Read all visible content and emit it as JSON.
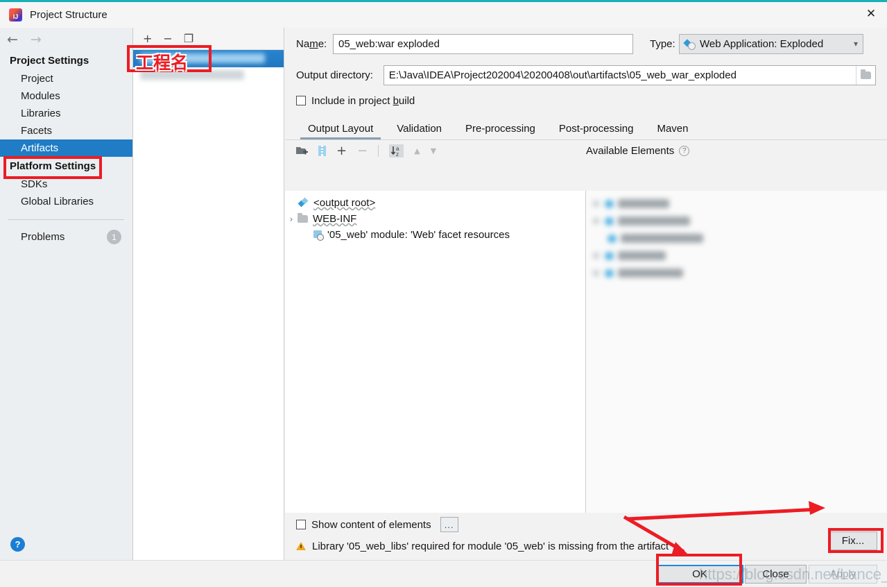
{
  "window": {
    "title": "Project Structure",
    "logo_icon": "intellij-idea-logo",
    "close_icon": "close-icon",
    "accent_color": "#18b0b8"
  },
  "nav": {
    "back_icon": "arrow-left-icon",
    "forward_icon": "arrow-right-icon"
  },
  "sidebar": {
    "project_settings_header": "Project Settings",
    "project_items": [
      {
        "label": "Project"
      },
      {
        "label": "Modules"
      },
      {
        "label": "Libraries"
      },
      {
        "label": "Facets"
      },
      {
        "label": "Artifacts"
      }
    ],
    "selected_item": "Artifacts",
    "platform_settings_header": "Platform Settings",
    "platform_items": [
      {
        "label": "SDKs"
      },
      {
        "label": "Global Libraries"
      }
    ],
    "problems_label": "Problems",
    "problems_count": "1",
    "help_icon": "help-icon",
    "help_glyph": "?"
  },
  "artifacts_panel": {
    "add_icon": "plus-icon",
    "remove_icon": "minus-icon",
    "copy_icon": "copy-icon",
    "add_glyph": "+",
    "remove_glyph": "−",
    "copy_glyph": "❐"
  },
  "form": {
    "name_label": "Name:",
    "name_label_prefix": "Na",
    "name_label_accel": "m",
    "name_label_suffix": "e:",
    "name_value": "05_web:war exploded",
    "type_label": "Type:",
    "type_value": "Web Application: Exploded",
    "type_icon": "web-application-icon",
    "type_chevron": "chevron-down-icon",
    "chevron_glyph": "⌄",
    "output_dir_label": "Output directory:",
    "output_dir_value": "E:\\Java\\IDEA\\Project202004\\20200408\\out\\artifacts\\05_web_war_exploded",
    "browse_icon": "folder-browse-icon",
    "include_build_prefix": "Include in project ",
    "include_build_accel": "b",
    "include_build_suffix": "uild",
    "include_build_label": "Include in project build",
    "include_build_checked": false
  },
  "tabs": [
    {
      "label": "Output Layout",
      "active": true
    },
    {
      "label": "Validation",
      "active": false
    },
    {
      "label": "Pre-processing",
      "active": false
    },
    {
      "label": "Post-processing",
      "active": false
    },
    {
      "label": "Maven",
      "active": false
    }
  ],
  "layout_toolbar": {
    "create_directory_icon": "add-directory-icon",
    "create_archive_icon": "add-archive-icon",
    "add_copy_icon": "plus-dropdown-icon",
    "remove_icon": "minus-icon",
    "sort_icon": "sort-alphabetically-icon",
    "move_up_icon": "arrow-up-icon",
    "move_down_icon": "arrow-down-icon",
    "plus_glyph": "+",
    "minus_glyph": "−",
    "up_glyph": "▲",
    "down_glyph": "▼",
    "available_elements_label": "Available Elements",
    "available_help_icon": "help-icon",
    "available_help_glyph": "?"
  },
  "output_tree": [
    {
      "label": "<output root>",
      "icon": "output-root-icon",
      "twisty": "",
      "indent": 0
    },
    {
      "label": "WEB-INF",
      "icon": "folder-icon",
      "twisty": "›",
      "indent": 0
    },
    {
      "label": "'05_web' module: 'Web' facet resources",
      "icon": "facet-resources-icon",
      "twisty": "",
      "indent": 1
    }
  ],
  "available_elements_blurred_rows": 5,
  "bottom": {
    "show_content_label": "Show content of elements",
    "show_content_checked": false,
    "dots_button_label": "...",
    "warning_icon": "warning-triangle-icon",
    "warning_text": "Library '05_web_libs' required for module '05_web' is missing from the artifact",
    "fix_button_label": "Fix..."
  },
  "footer": {
    "ok_label": "OK",
    "close_label": "Close",
    "apply_label": "Apply",
    "apply_disabled": true
  },
  "annotations": {
    "project_name_cn": "工程名",
    "highlight_color": "#ec1c24"
  },
  "watermark": "https://blog.csdn.net/Lance_welcome"
}
